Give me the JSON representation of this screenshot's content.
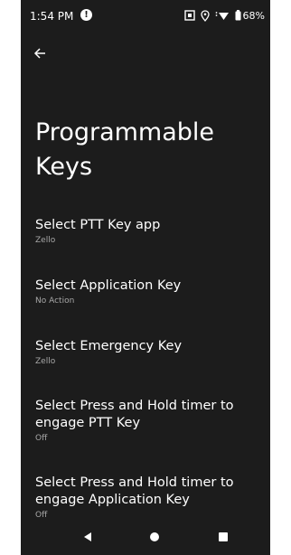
{
  "status_bar": {
    "time": "1:54 PM",
    "alert_glyph": "!",
    "battery": "68%",
    "icons": [
      "alert-icon",
      "screenshot-icon",
      "location-icon",
      "wifi-icon",
      "battery-icon"
    ]
  },
  "page": {
    "title": "Programmable Keys"
  },
  "settings": [
    {
      "title": "Select PTT Key app",
      "summary": "Zello"
    },
    {
      "title": "Select Application Key",
      "summary": "No Action"
    },
    {
      "title": "Select Emergency Key",
      "summary": "Zello"
    },
    {
      "title": "Select Press and Hold timer to engage PTT Key",
      "summary": "Off"
    },
    {
      "title": "Select Press and Hold timer to engage Application Key",
      "summary": "Off"
    }
  ],
  "nav": {
    "buttons": [
      "back-triangle-icon",
      "home-circle-icon",
      "overview-square-icon"
    ]
  },
  "colors": {
    "background": "#1c1c1c",
    "text": "#ffffff",
    "secondary_text": "#a8a8a8"
  }
}
